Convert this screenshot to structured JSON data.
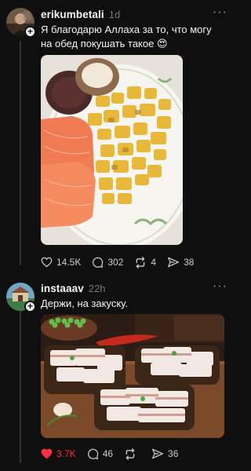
{
  "posts": [
    {
      "username": "erikumbetali",
      "time": "1d",
      "text": "Я благодарю Аллаха за то, что могу на обед покушать такое 😍",
      "likes": "14.5K",
      "comments": "302",
      "reposts": "4",
      "shares": "38",
      "liked": false
    },
    {
      "username": "instaaav",
      "time": "22h",
      "text": "Держи, на закуску.",
      "likes": "3.7K",
      "comments": "46",
      "reposts": "",
      "shares": "36",
      "liked": true
    }
  ],
  "colors": {
    "background": "#0f0f0f",
    "text": "#f3f5f7",
    "muted": "#777777",
    "like_active": "#ff3040"
  },
  "icons": [
    "more-icon",
    "heart-icon",
    "comment-icon",
    "repost-icon",
    "share-icon",
    "follow-plus-icon"
  ]
}
